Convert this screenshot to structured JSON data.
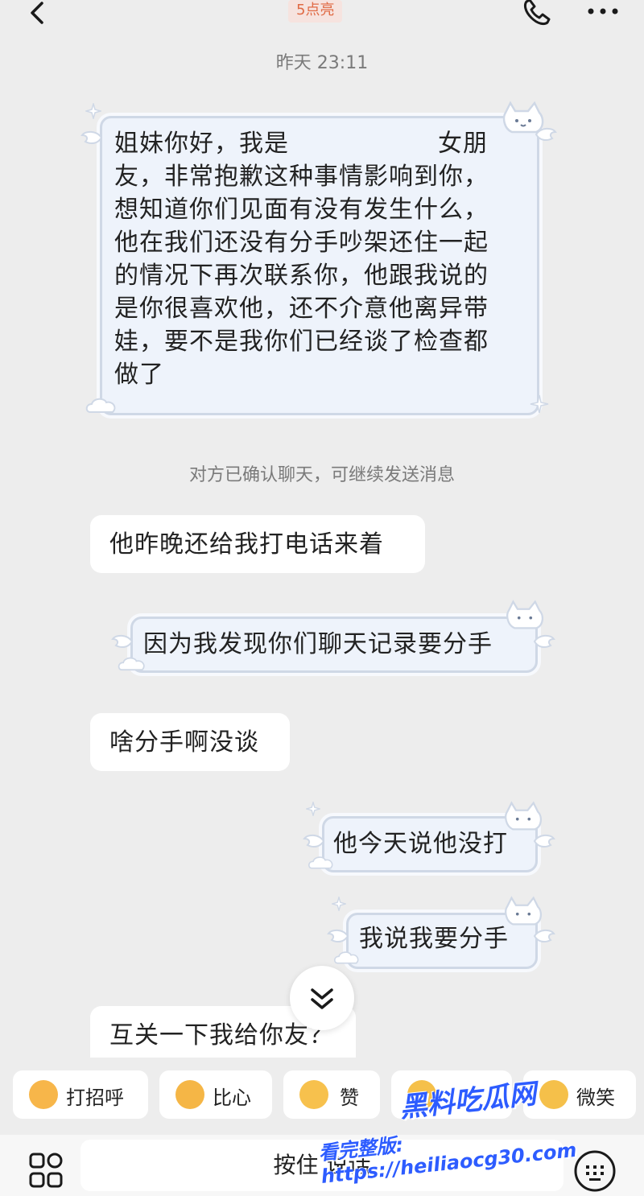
{
  "header": {
    "name_badge": "5点亮"
  },
  "timestamp": "昨天 23:11",
  "messages": [
    {
      "side": "right",
      "style": "decorated",
      "lines": [
        "姐妹你好，我是",
        "友，非常抱歉这种事情影响到你，",
        "想知道你们见面有没有发生什么，",
        "他在我们还没有分手吵架还住一起",
        "的情况下再次联系你，他跟我说的",
        "是你很喜欢他，还不介意他离异带",
        "娃，要不是我你们已经谈了检查都",
        "做了"
      ],
      "first_line_tail": "女朋"
    },
    {
      "side": "left",
      "style": "plain",
      "text": "他昨晚还给我打电话来着"
    },
    {
      "side": "right",
      "style": "decorated",
      "text": "因为我发现你们聊天记录要分手"
    },
    {
      "side": "left",
      "style": "plain",
      "text": "啥分手啊没谈"
    },
    {
      "side": "right",
      "style": "decorated",
      "text": "他今天说他没打"
    },
    {
      "side": "right",
      "style": "decorated",
      "text": "我说我要分手"
    },
    {
      "side": "left",
      "style": "plain",
      "text": "互关一下我给你友？"
    }
  ],
  "system_note": "对方已确认聊天，可继续发送消息",
  "quick_replies": [
    {
      "label": "打招呼",
      "icon": "wave-emoji-icon"
    },
    {
      "label": "比心",
      "icon": "heart-hand-emoji-icon"
    },
    {
      "label": "赞",
      "icon": "thumbs-up-emoji-icon"
    },
    {
      "label": "",
      "icon": "emoji-icon"
    },
    {
      "label": "微笑",
      "icon": "smile-emoji-icon"
    }
  ],
  "input": {
    "hold_to_talk": "按住 说话"
  },
  "watermark": {
    "line1": "黑料吃瓜网",
    "line2": "看完整版: https://heiliaocg30.com"
  },
  "colors": {
    "background": "#ededed",
    "badge_text": "#e06a45",
    "watermark": "#2d5cff"
  }
}
